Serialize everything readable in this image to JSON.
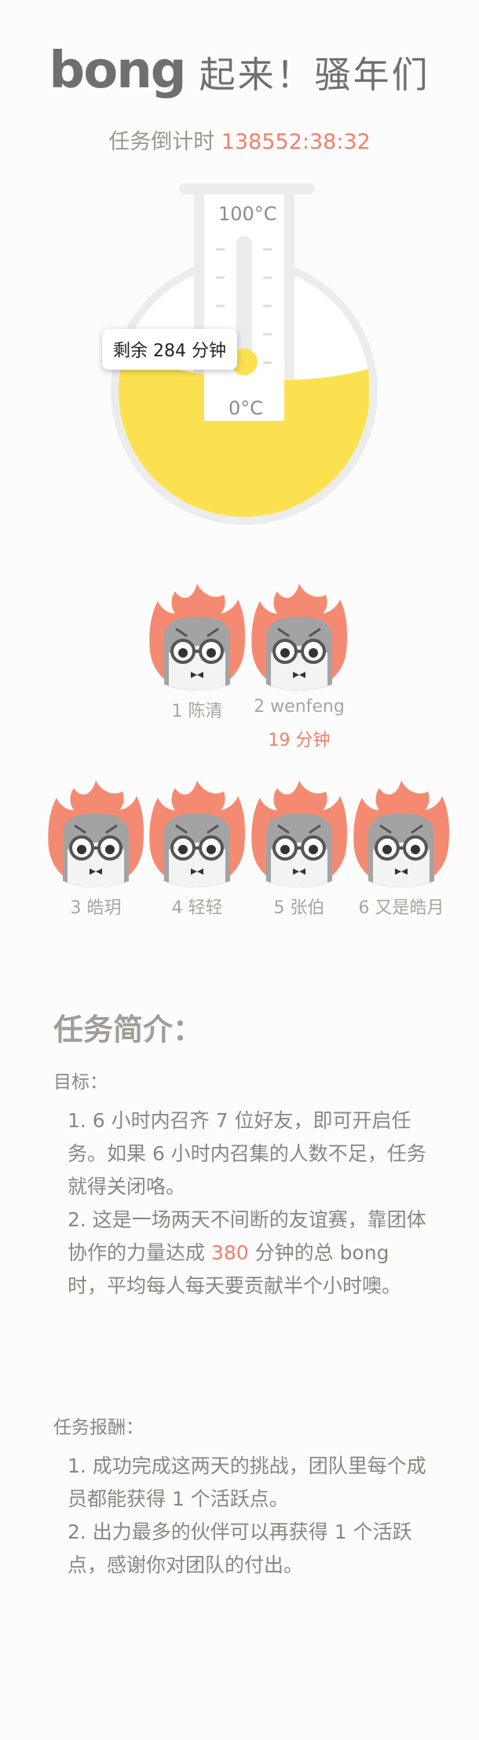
{
  "header": {
    "logo": "bong",
    "slogan": "起来！骚年们"
  },
  "countdown": {
    "label": "任务倒计时 ",
    "value": "138552:38:32"
  },
  "flask": {
    "top_temp": "100°C",
    "bottom_temp": "0°C",
    "remaining": "剩余 284 分钟",
    "fill_color": "#fbe150",
    "liquid_level_fraction": 0.62,
    "thermometer_level_fraction": 0.05
  },
  "members": [
    {
      "name": "1 陈清",
      "extra": ""
    },
    {
      "name": "2 wenfeng",
      "extra": "19 分钟"
    },
    {
      "name": "3 皓玥",
      "extra": ""
    },
    {
      "name": "4 轻轻",
      "extra": ""
    },
    {
      "name": "5 张伯",
      "extra": ""
    },
    {
      "name": "6 又是皓月",
      "extra": ""
    }
  ],
  "intro": {
    "title": "任务简介：",
    "goal_label": "目标：",
    "goal_1": "1. 6 小时内召齐 7 位好友，即可开启任务。如果 6 小时内召集的人数不足，任务就得关闭咯。",
    "goal_2_pre": "2. 这是一场两天不间断的友谊赛，靠团体协作的力量达成 ",
    "goal_2_value": "380",
    "goal_2_post": " 分钟的总 bong 时，平均每人每天要贡献半个小时噢。",
    "reward_label": "任务报酬：",
    "reward_1": "1. 成功完成这两天的挑战，团队里每个成员都能获得 1 个活跃点。",
    "reward_2": "2. 出力最多的伙伴可以再获得 1 个活跃点，感谢你对团队的付出。"
  },
  "colors": {
    "accent": "#f08068",
    "flame": "#f58a72",
    "liquid": "#fbe150",
    "glass": "#ececec"
  }
}
